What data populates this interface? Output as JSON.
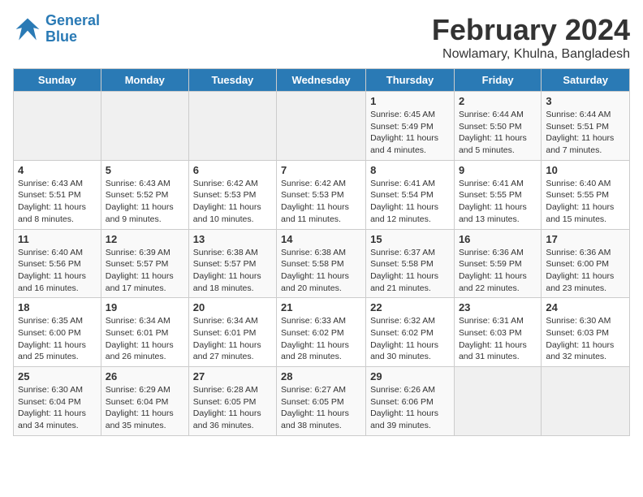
{
  "logo": {
    "line1": "General",
    "line2": "Blue"
  },
  "title": "February 2024",
  "subtitle": "Nowlamary, Khulna, Bangladesh",
  "header_color": "#2a7ab5",
  "days_of_week": [
    "Sunday",
    "Monday",
    "Tuesday",
    "Wednesday",
    "Thursday",
    "Friday",
    "Saturday"
  ],
  "weeks": [
    [
      {
        "num": "",
        "info": ""
      },
      {
        "num": "",
        "info": ""
      },
      {
        "num": "",
        "info": ""
      },
      {
        "num": "",
        "info": ""
      },
      {
        "num": "1",
        "info": "Sunrise: 6:45 AM\nSunset: 5:49 PM\nDaylight: 11 hours and 4 minutes."
      },
      {
        "num": "2",
        "info": "Sunrise: 6:44 AM\nSunset: 5:50 PM\nDaylight: 11 hours and 5 minutes."
      },
      {
        "num": "3",
        "info": "Sunrise: 6:44 AM\nSunset: 5:51 PM\nDaylight: 11 hours and 7 minutes."
      }
    ],
    [
      {
        "num": "4",
        "info": "Sunrise: 6:43 AM\nSunset: 5:51 PM\nDaylight: 11 hours and 8 minutes."
      },
      {
        "num": "5",
        "info": "Sunrise: 6:43 AM\nSunset: 5:52 PM\nDaylight: 11 hours and 9 minutes."
      },
      {
        "num": "6",
        "info": "Sunrise: 6:42 AM\nSunset: 5:53 PM\nDaylight: 11 hours and 10 minutes."
      },
      {
        "num": "7",
        "info": "Sunrise: 6:42 AM\nSunset: 5:53 PM\nDaylight: 11 hours and 11 minutes."
      },
      {
        "num": "8",
        "info": "Sunrise: 6:41 AM\nSunset: 5:54 PM\nDaylight: 11 hours and 12 minutes."
      },
      {
        "num": "9",
        "info": "Sunrise: 6:41 AM\nSunset: 5:55 PM\nDaylight: 11 hours and 13 minutes."
      },
      {
        "num": "10",
        "info": "Sunrise: 6:40 AM\nSunset: 5:55 PM\nDaylight: 11 hours and 15 minutes."
      }
    ],
    [
      {
        "num": "11",
        "info": "Sunrise: 6:40 AM\nSunset: 5:56 PM\nDaylight: 11 hours and 16 minutes."
      },
      {
        "num": "12",
        "info": "Sunrise: 6:39 AM\nSunset: 5:57 PM\nDaylight: 11 hours and 17 minutes."
      },
      {
        "num": "13",
        "info": "Sunrise: 6:38 AM\nSunset: 5:57 PM\nDaylight: 11 hours and 18 minutes."
      },
      {
        "num": "14",
        "info": "Sunrise: 6:38 AM\nSunset: 5:58 PM\nDaylight: 11 hours and 20 minutes."
      },
      {
        "num": "15",
        "info": "Sunrise: 6:37 AM\nSunset: 5:58 PM\nDaylight: 11 hours and 21 minutes."
      },
      {
        "num": "16",
        "info": "Sunrise: 6:36 AM\nSunset: 5:59 PM\nDaylight: 11 hours and 22 minutes."
      },
      {
        "num": "17",
        "info": "Sunrise: 6:36 AM\nSunset: 6:00 PM\nDaylight: 11 hours and 23 minutes."
      }
    ],
    [
      {
        "num": "18",
        "info": "Sunrise: 6:35 AM\nSunset: 6:00 PM\nDaylight: 11 hours and 25 minutes."
      },
      {
        "num": "19",
        "info": "Sunrise: 6:34 AM\nSunset: 6:01 PM\nDaylight: 11 hours and 26 minutes."
      },
      {
        "num": "20",
        "info": "Sunrise: 6:34 AM\nSunset: 6:01 PM\nDaylight: 11 hours and 27 minutes."
      },
      {
        "num": "21",
        "info": "Sunrise: 6:33 AM\nSunset: 6:02 PM\nDaylight: 11 hours and 28 minutes."
      },
      {
        "num": "22",
        "info": "Sunrise: 6:32 AM\nSunset: 6:02 PM\nDaylight: 11 hours and 30 minutes."
      },
      {
        "num": "23",
        "info": "Sunrise: 6:31 AM\nSunset: 6:03 PM\nDaylight: 11 hours and 31 minutes."
      },
      {
        "num": "24",
        "info": "Sunrise: 6:30 AM\nSunset: 6:03 PM\nDaylight: 11 hours and 32 minutes."
      }
    ],
    [
      {
        "num": "25",
        "info": "Sunrise: 6:30 AM\nSunset: 6:04 PM\nDaylight: 11 hours and 34 minutes."
      },
      {
        "num": "26",
        "info": "Sunrise: 6:29 AM\nSunset: 6:04 PM\nDaylight: 11 hours and 35 minutes."
      },
      {
        "num": "27",
        "info": "Sunrise: 6:28 AM\nSunset: 6:05 PM\nDaylight: 11 hours and 36 minutes."
      },
      {
        "num": "28",
        "info": "Sunrise: 6:27 AM\nSunset: 6:05 PM\nDaylight: 11 hours and 38 minutes."
      },
      {
        "num": "29",
        "info": "Sunrise: 6:26 AM\nSunset: 6:06 PM\nDaylight: 11 hours and 39 minutes."
      },
      {
        "num": "",
        "info": ""
      },
      {
        "num": "",
        "info": ""
      }
    ]
  ]
}
